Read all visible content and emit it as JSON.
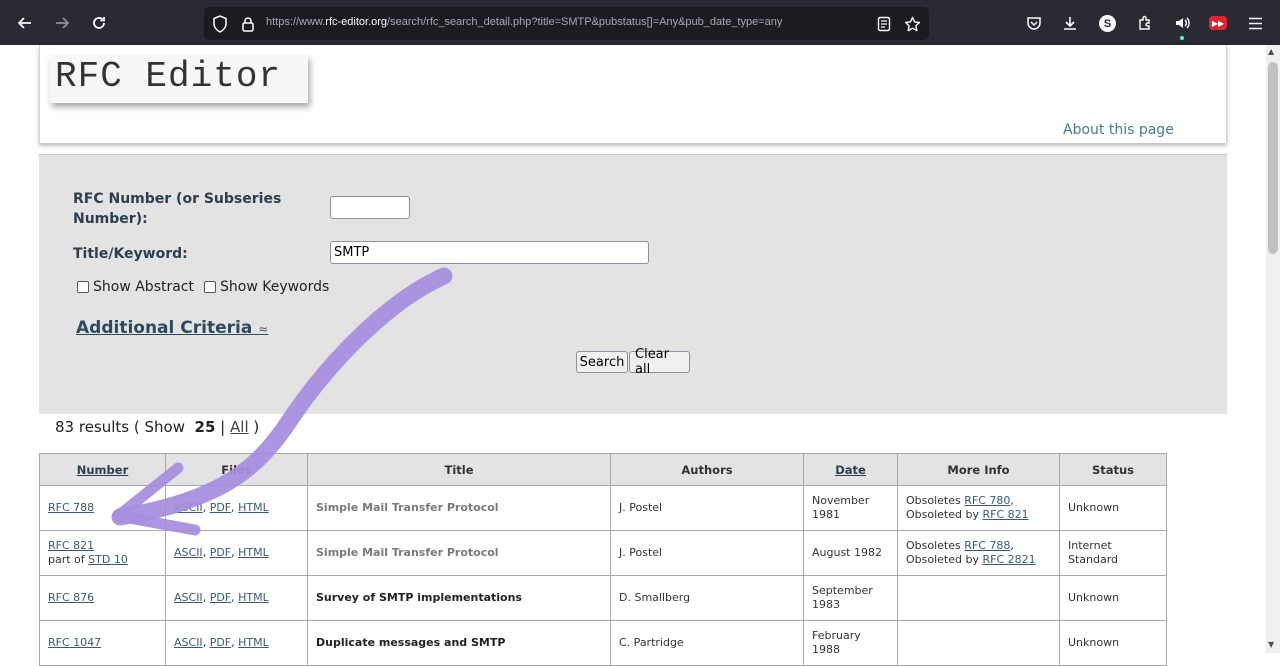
{
  "browser": {
    "url_prefix": "https://www.",
    "url_host": "rfc-editor.org",
    "url_rest": "/search/rfc_search_detail.php?title=SMTP&pubstatus[]=Any&pub_date_type=any",
    "profile_letter": "S"
  },
  "header": {
    "logo": "RFC Editor",
    "about_link": "About this page"
  },
  "search": {
    "rfc_number_label": "RFC Number (or Subseries Number):",
    "rfc_number_value": "",
    "title_label": "Title/Keyword:",
    "title_value": "SMTP",
    "show_abstract": "Show Abstract",
    "show_keywords": "Show Keywords",
    "additional_criteria": "Additional Criteria",
    "search_button": "Search",
    "clear_button": "Clear all"
  },
  "results": {
    "count_text": "83 results ( Show",
    "show_count": "25",
    "separator": "|",
    "all_link": "All",
    "close": ")"
  },
  "table": {
    "headers": {
      "number": "Number",
      "files": "Files",
      "title": "Title",
      "authors": "Authors",
      "date": "Date",
      "more_info": "More Info",
      "status": "Status"
    },
    "rows": [
      {
        "number": "RFC 788",
        "sub": "",
        "sub_link": "",
        "files": [
          "ASCII",
          "PDF",
          "HTML"
        ],
        "title": "Simple Mail Transfer Protocol",
        "authors": "J. Postel",
        "date": "November 1981",
        "info_a": "Obsoletes",
        "info_a_link": "RFC 780",
        "info_b": "Obsoleted by",
        "info_b_link": "RFC 821",
        "status": "Unknown"
      },
      {
        "number": "RFC 821",
        "sub": "part of",
        "sub_link": "STD 10",
        "files": [
          "ASCII",
          "PDF",
          "HTML"
        ],
        "title": "Simple Mail Transfer Protocol",
        "authors": "J. Postel",
        "date": "August 1982",
        "info_a": "Obsoletes",
        "info_a_link": "RFC 788",
        "info_b": "Obsoleted by",
        "info_b_link": "RFC 2821",
        "status": "Internet Standard"
      },
      {
        "number": "RFC 876",
        "sub": "",
        "sub_link": "",
        "files": [
          "ASCII",
          "PDF",
          "HTML"
        ],
        "title": "Survey of SMTP implementations",
        "authors": "D. Smallberg",
        "date": "September 1983",
        "info_a": "",
        "info_a_link": "",
        "info_b": "",
        "info_b_link": "",
        "status": "Unknown"
      },
      {
        "number": "RFC 1047",
        "sub": "",
        "sub_link": "",
        "files": [
          "ASCII",
          "PDF",
          "HTML"
        ],
        "title": "Duplicate messages and SMTP",
        "authors": "C. Partridge",
        "date": "February 1988",
        "info_a": "",
        "info_a_link": "",
        "info_b": "",
        "info_b_link": "",
        "status": "Unknown"
      }
    ]
  },
  "annotation": {
    "arrow_color": "#a58de0"
  },
  "icons": [
    "back-arrow-icon",
    "forward-arrow-icon",
    "reload-icon",
    "shield-icon",
    "lock-icon",
    "reader-view-icon",
    "bookmark-star-icon",
    "pocket-icon",
    "download-icon",
    "extensions-icon",
    "speaker-icon",
    "menu-icon"
  ]
}
